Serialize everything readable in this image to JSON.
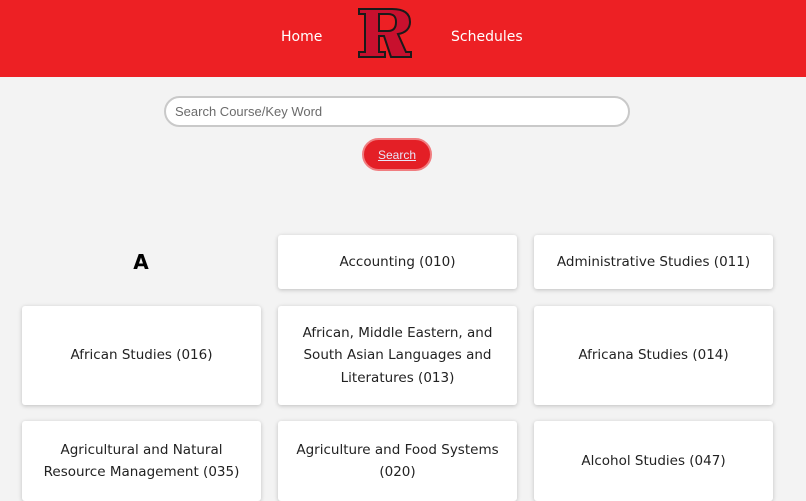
{
  "nav": {
    "home_label": "Home",
    "schedules_label": "Schedules",
    "logo_name": "rutgers-r-logo",
    "brand_color": "#ed2024"
  },
  "search": {
    "placeholder": "Search Course/Key Word",
    "value": "",
    "button_label": "Search"
  },
  "section": {
    "letter": "A"
  },
  "subjects": [
    {
      "label": "Accounting (010)"
    },
    {
      "label": "Administrative Studies (011)"
    },
    {
      "label": "African Studies (016)"
    },
    {
      "label": "African, Middle Eastern, and South Asian Languages and Literatures (013)"
    },
    {
      "label": "Africana Studies (014)"
    },
    {
      "label": "Agricultural and Natural Resource Management (035)"
    },
    {
      "label": "Agriculture and Food Systems (020)"
    },
    {
      "label": "Alcohol Studies (047)"
    }
  ]
}
